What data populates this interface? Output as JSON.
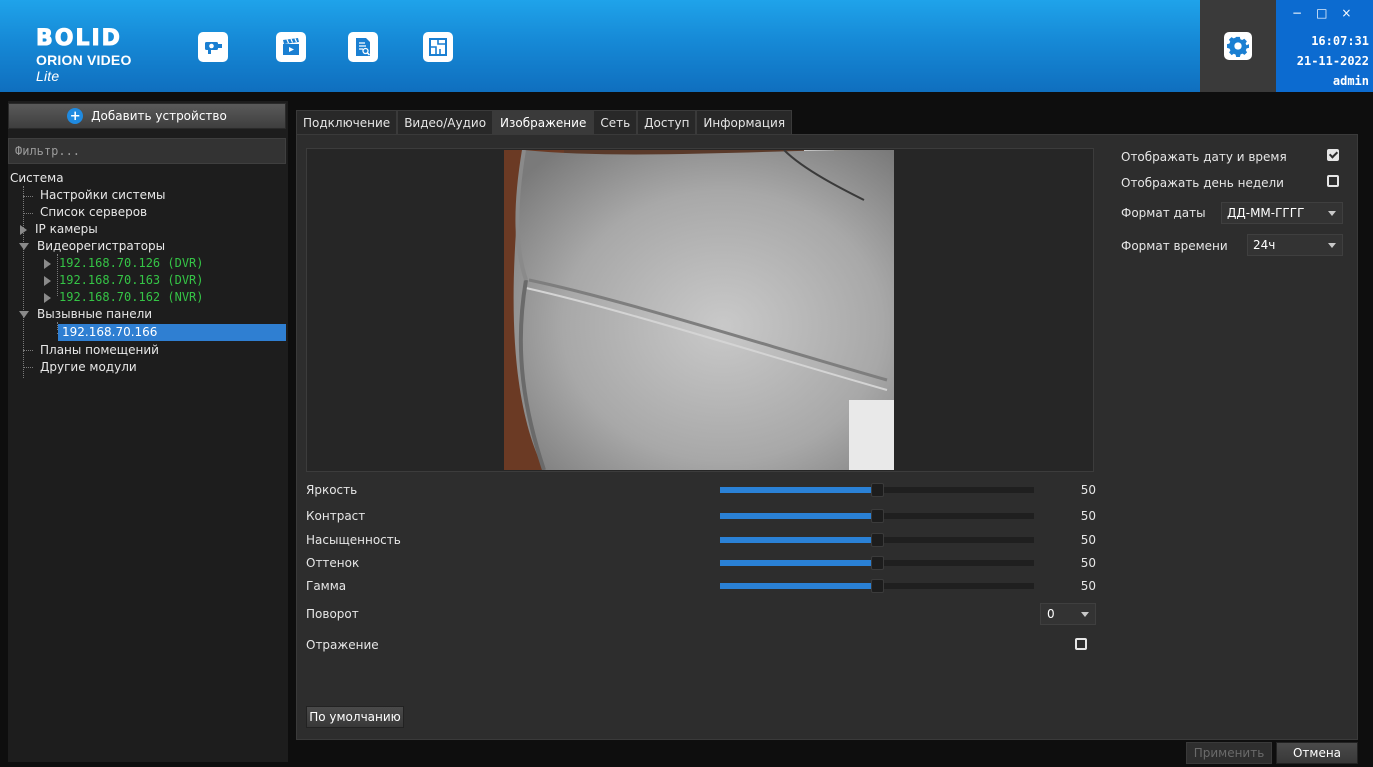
{
  "header": {
    "brand_logo": "BOLID",
    "brand_title": "ORION VIDEO",
    "brand_suffix": "Lite",
    "toolbar_icons": [
      "camera-icon",
      "video-clip-icon",
      "report-icon",
      "floor-plan-icon"
    ],
    "settings_icon": "gear-icon",
    "window_controls": {
      "minimize": "−",
      "maximize": "□",
      "close": "×"
    },
    "time": "16:07:31",
    "date": "21-11-2022",
    "user": "admin"
  },
  "sidebar": {
    "add_device_label": "Добавить устройство",
    "filter_placeholder": "Фильтр...",
    "tree": {
      "root": "Система",
      "system_settings": "Настройки системы",
      "server_list": "Список серверов",
      "ip_cameras": "IP камеры",
      "dvrs": "Видеорегистраторы",
      "dvr_1": "192.168.70.126 (DVR)",
      "dvr_2": "192.168.70.163 (DVR)",
      "dvr_3": "192.168.70.162 (NVR)",
      "call_panels": "Вызывные панели",
      "panel_1": "192.168.70.166",
      "floor_plans": "Планы помещений",
      "other_modules": "Другие модули"
    }
  },
  "tabs": [
    "Подключение",
    "Видео/Аудио",
    "Изображение",
    "Сеть",
    "Доступ",
    "Информация"
  ],
  "active_tab": "Изображение",
  "image": {
    "sliders": [
      {
        "label": "Яркость",
        "value": "50",
        "fraction": 0.5
      },
      {
        "label": "Контраст",
        "value": "50",
        "fraction": 0.5
      },
      {
        "label": "Насыщенность",
        "value": "50",
        "fraction": 0.5
      },
      {
        "label": "Оттенок",
        "value": "50",
        "fraction": 0.5
      },
      {
        "label": "Гамма",
        "value": "50",
        "fraction": 0.5
      }
    ],
    "rotation_label": "Поворот",
    "rotation_value": "0",
    "mirror_label": "Отражение",
    "mirror_checked": false,
    "default_button": "По умолчанию"
  },
  "overlay": {
    "show_datetime_label": "Отображать дату и время",
    "show_datetime_checked": true,
    "show_weekday_label": "Отображать день недели",
    "show_weekday_checked": false,
    "date_format_label": "Формат даты",
    "date_format_value": "ДД-ММ-ГГГГ",
    "time_format_label": "Формат времени",
    "time_format_value": "24ч"
  },
  "footer": {
    "apply_label": "Применить",
    "cancel_label": "Отмена"
  },
  "colors": {
    "header_blue": "#1689d6",
    "accent_blue": "#2a81d6",
    "device_online_green": "#35c446",
    "panel_bg": "#2d2d2d"
  }
}
